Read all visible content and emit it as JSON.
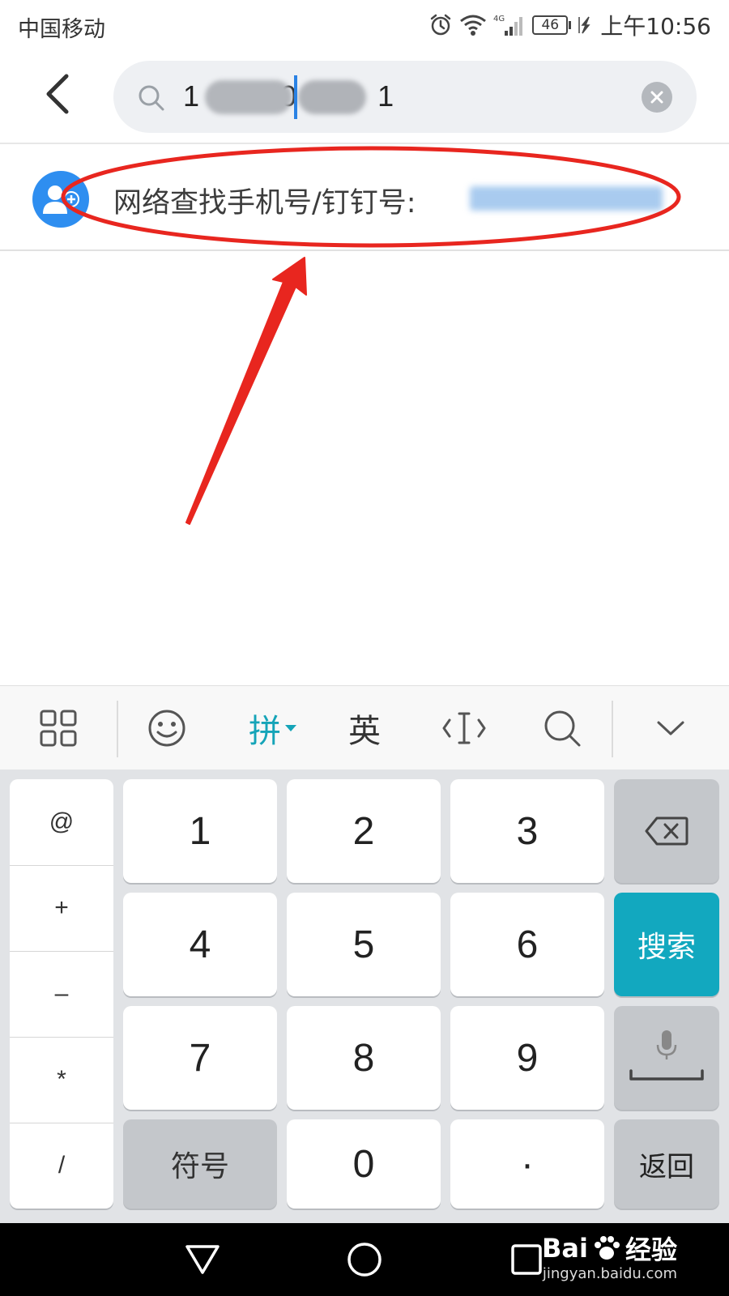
{
  "status_bar": {
    "carrier": "中国移动",
    "network_type": "4G",
    "battery_level": "46",
    "time": "上午10:56"
  },
  "header": {
    "back_icon": "chevron-left-icon",
    "search": {
      "value": "1          0          1",
      "clear_icon": "clear-circle-icon"
    }
  },
  "result": {
    "icon": "add-contact-icon",
    "label": "网络查找手机号/钉钉号: "
  },
  "annotation": {
    "color": "#e8261f"
  },
  "keyboard": {
    "toolbar": {
      "menu_icon": "grid-icon",
      "emoji_icon": "smile-icon",
      "pinyin": "拼",
      "english": "英",
      "cursor_icon": "cursor-move-icon",
      "search_icon": "search-icon",
      "collapse_icon": "chevron-down-icon"
    },
    "side_keys": [
      "@",
      "+",
      "–",
      "*",
      "/"
    ],
    "rows": [
      [
        "1",
        "2",
        "3"
      ],
      [
        "4",
        "5",
        "6"
      ],
      [
        "7",
        "8",
        "9"
      ]
    ],
    "symbol_key": "符号",
    "zero_key": "0",
    "dot_key": "·",
    "search_key": "搜索",
    "return_key": "返回",
    "backspace_icon": "backspace-icon",
    "voice_icon": "microphone-icon",
    "accent_color": "#12a8bf"
  },
  "nav_bar": {
    "back_icon": "triangle-back-icon",
    "home_icon": "circle-home-icon",
    "recents_icon": "square-recents-icon"
  },
  "watermark": {
    "brand_left": "Bai",
    "brand_right": "经验",
    "url": "jingyan.baidu.com"
  }
}
